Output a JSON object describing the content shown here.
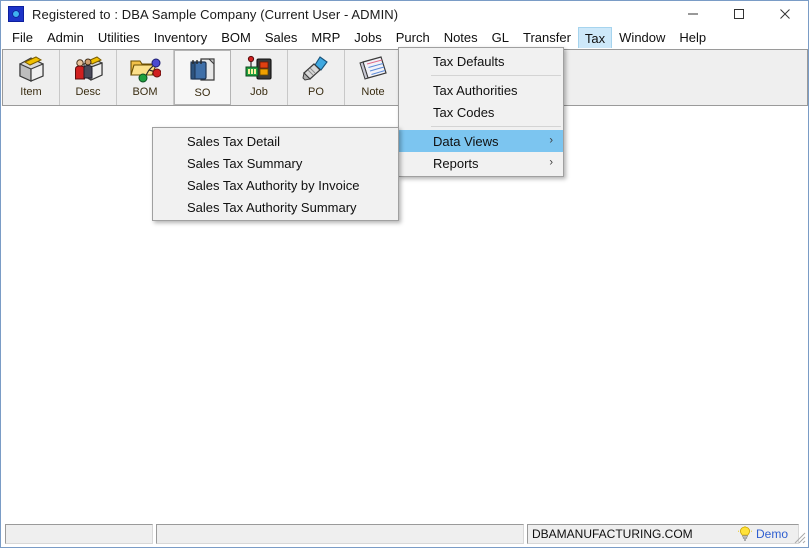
{
  "window": {
    "title": "Registered to : DBA Sample Company (Current User - ADMIN)",
    "app_icon": "app-logo-icon",
    "controls": {
      "minimize": "minimize-icon",
      "maximize": "maximize-icon",
      "close": "close-icon"
    }
  },
  "menu_bar": {
    "items": [
      {
        "label": "File",
        "selected": false
      },
      {
        "label": "Admin",
        "selected": false
      },
      {
        "label": "Utilities",
        "selected": false
      },
      {
        "label": "Inventory",
        "selected": false
      },
      {
        "label": "BOM",
        "selected": false
      },
      {
        "label": "Sales",
        "selected": false
      },
      {
        "label": "MRP",
        "selected": false
      },
      {
        "label": "Jobs",
        "selected": false
      },
      {
        "label": "Purch",
        "selected": false
      },
      {
        "label": "Notes",
        "selected": false
      },
      {
        "label": "GL",
        "selected": false
      },
      {
        "label": "Transfer",
        "selected": false
      },
      {
        "label": "Tax",
        "selected": true
      },
      {
        "label": "Window",
        "selected": false
      },
      {
        "label": "Help",
        "selected": false
      }
    ]
  },
  "toolbar": {
    "buttons": [
      {
        "label": "Item",
        "icon": "item-box-icon",
        "pressed": false
      },
      {
        "label": "Desc",
        "icon": "desc-people-box-icon",
        "pressed": false
      },
      {
        "label": "BOM",
        "icon": "bom-folder-nodes-icon",
        "pressed": false
      },
      {
        "label": "SO",
        "icon": "so-notepad-icon",
        "pressed": true
      },
      {
        "label": "Job",
        "icon": "job-machine-icon",
        "pressed": false
      },
      {
        "label": "PO",
        "icon": "po-stamp-icon",
        "pressed": false
      },
      {
        "label": "Note",
        "icon": "note-pad-icon",
        "pressed": false
      }
    ]
  },
  "tax_menu": {
    "items": [
      {
        "label": "Tax Defaults",
        "highlight": false,
        "has_submenu": false,
        "separator_after": true
      },
      {
        "label": "Tax Authorities",
        "highlight": false,
        "has_submenu": false,
        "separator_after": false
      },
      {
        "label": "Tax Codes",
        "highlight": false,
        "has_submenu": false,
        "separator_after": true
      },
      {
        "label": "Data Views",
        "highlight": true,
        "has_submenu": true,
        "separator_after": false
      },
      {
        "label": "Reports",
        "highlight": false,
        "has_submenu": true,
        "separator_after": false
      }
    ],
    "submenu_arrow": "›"
  },
  "data_views_submenu": {
    "items": [
      {
        "label": "Sales Tax Detail"
      },
      {
        "label": "Sales Tax Summary"
      },
      {
        "label": "Sales Tax Authority by Invoice"
      },
      {
        "label": "Sales Tax Authority Summary"
      }
    ]
  },
  "status_bar": {
    "panel1": "",
    "panel2": "",
    "url": "DBAMANUFACTURING.COM",
    "demo_label": "Demo",
    "demo_icon": "lightbulb-icon"
  },
  "colors": {
    "menu_highlight": "#7cc5f0",
    "menubar_selected": "#cde8f9",
    "toolbar_bg": "#efefef",
    "window_border": "#7a9cc6",
    "demo_text": "#2f5fd0"
  }
}
